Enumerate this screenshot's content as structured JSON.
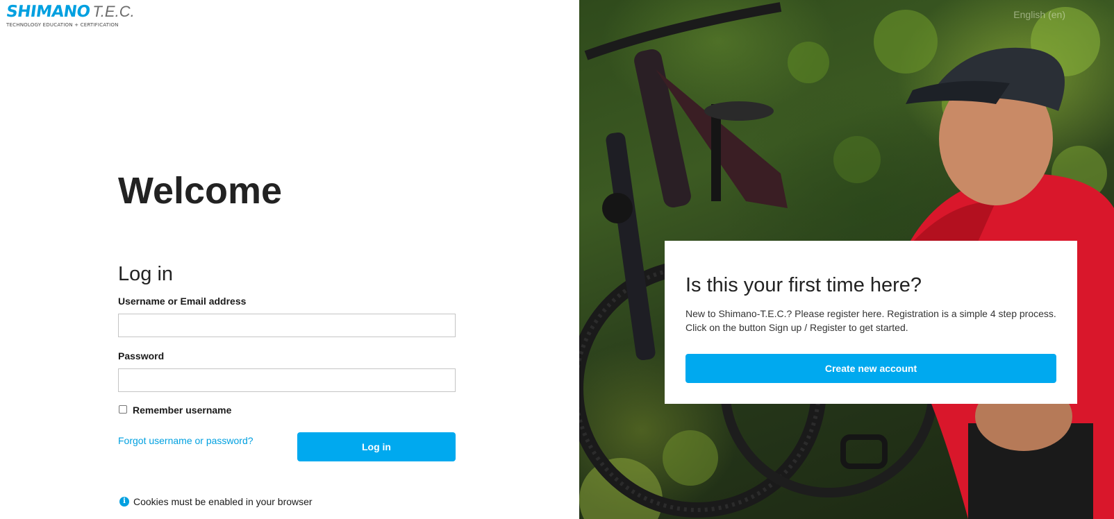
{
  "brand": {
    "name": "SHIMANO",
    "product": "T.E.C.",
    "tagline": "TECHNOLOGY EDUCATION + CERTIFICATION",
    "accent_color": "#00a0e0"
  },
  "header": {
    "language": "English (en)"
  },
  "login": {
    "welcome": "Welcome",
    "title": "Log in",
    "username_label": "Username or Email address",
    "username_value": "",
    "password_label": "Password",
    "password_value": "",
    "remember_label": "Remember username",
    "remember_checked": false,
    "forgot_link": "Forgot username or password?",
    "submit_label": "Log in",
    "cookies_notice": "Cookies must be enabled in your browser"
  },
  "signup": {
    "title": "Is this your first time here?",
    "text_line1": "New to Shimano-T.E.C.? Please register here. Registration is a simple 4 step process.",
    "text_line2": "Click on the button Sign up / Register to get started.",
    "button_label": "Create new account"
  },
  "icons": {
    "info": "info-icon",
    "checkbox": "checkbox-icon"
  },
  "colors": {
    "button": "#00a9ef",
    "link": "#00a0e0",
    "heading": "#222222"
  }
}
